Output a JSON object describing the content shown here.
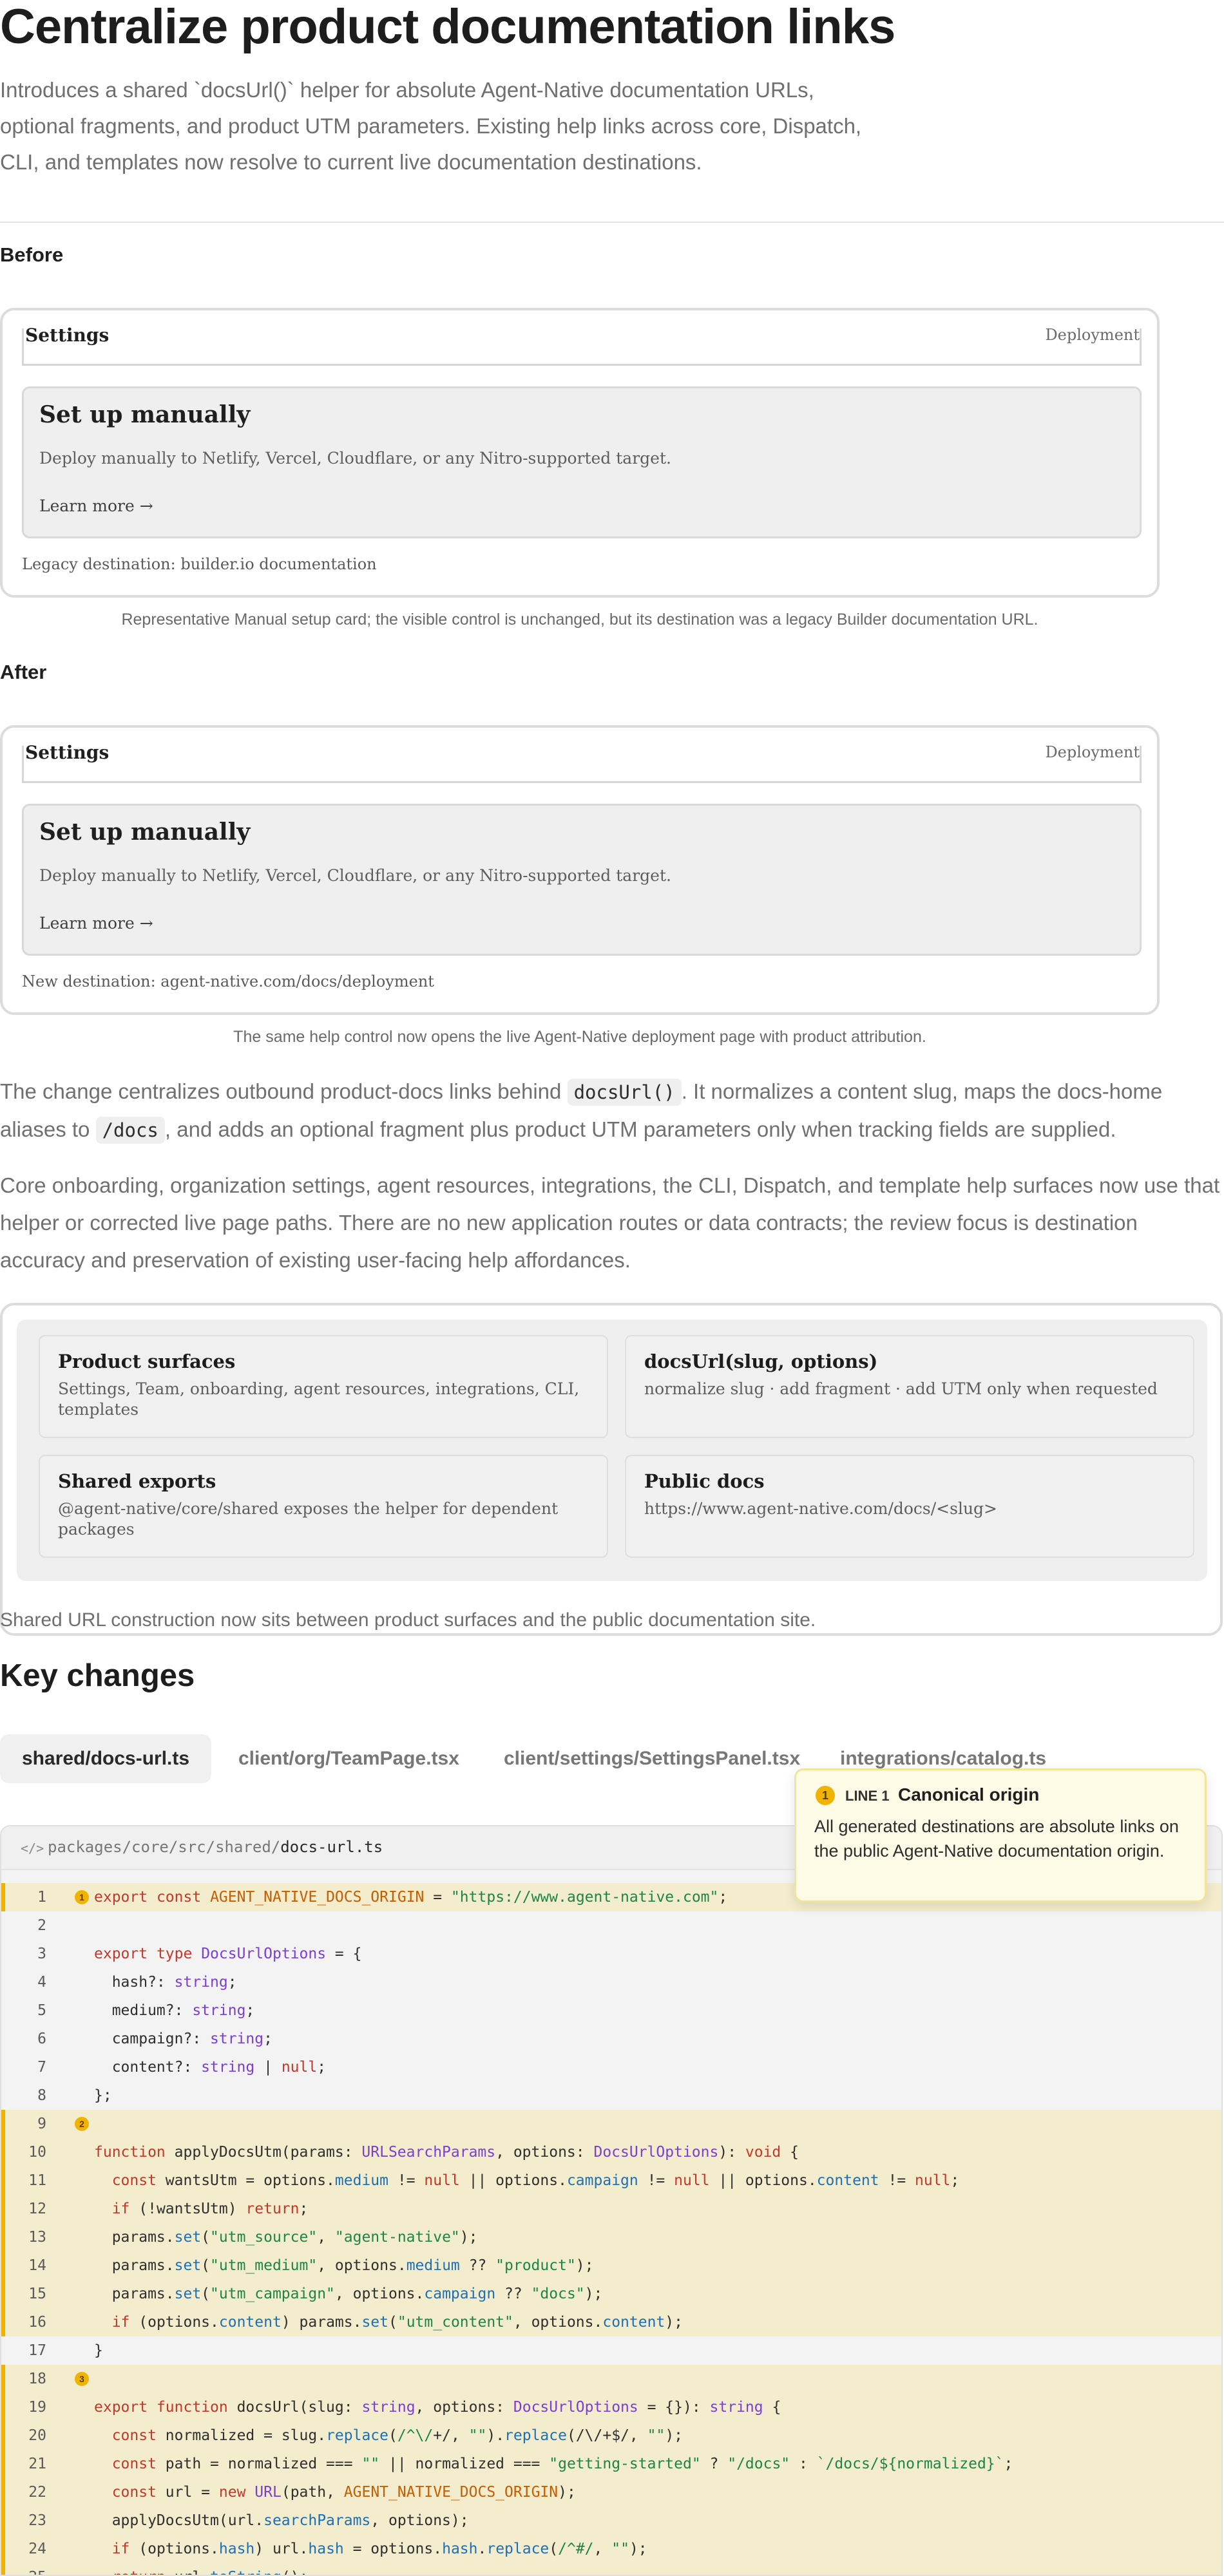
{
  "page": {
    "title": "Centralize product documentation links",
    "subtitle": "Introduces a shared `docsUrl()` helper for absolute Agent-Native documentation URLs, optional fragments, and product UTM parameters. Existing help links across core, Dispatch, CLI, and templates now resolve to current live documentation destinations."
  },
  "before": {
    "heading": "Before",
    "bar_left": "Settings",
    "bar_right": "Deployment",
    "card_title": "Set up manually",
    "card_desc": "Deploy manually to Netlify, Vercel, Cloudflare, or any Nitro-supported target.",
    "card_link": "Learn more →",
    "footer": "Legacy destination: builder.io documentation",
    "caption": "Representative Manual setup card; the visible control is unchanged, but its destination was a legacy Builder documentation URL."
  },
  "after": {
    "heading": "After",
    "bar_left": "Settings",
    "bar_right": "Deployment",
    "card_title": "Set up manually",
    "card_desc": "Deploy manually to Netlify, Vercel, Cloudflare, or any Nitro-supported target.",
    "card_link": "Learn more →",
    "footer": "New destination: agent-native.com/docs/deployment",
    "caption": "The same help control now opens the live Agent-Native deployment page with product attribution."
  },
  "body": {
    "p1_a": "The change centralizes outbound product-docs links behind ",
    "p1_code1": "docsUrl()",
    "p1_b": ". It normalizes a content slug, maps the docs-home aliases to ",
    "p1_code2": "/docs",
    "p1_c": ", and adds an optional fragment plus product UTM parameters only when tracking fields are supplied.",
    "p2": "Core onboarding, organization settings, agent resources, integrations, the CLI, Dispatch, and template help surfaces now use that helper or corrected live page paths. There are no new application routes or data contracts; the review focus is destination accuracy and preservation of existing user-facing help affordances."
  },
  "diagram": {
    "boxes": [
      {
        "title": "Product surfaces",
        "body": "Settings, Team, onboarding, agent resources, integrations, CLI, templates"
      },
      {
        "title": "docsUrl(slug, options)",
        "body": "normalize slug · add fragment · add UTM only when requested"
      },
      {
        "title": "Shared exports",
        "body": "@agent-native/core/shared exposes the helper for dependent packages"
      },
      {
        "title": "Public docs",
        "body": "https://www.agent-native.com/docs/<slug>"
      }
    ],
    "caption": "Shared URL construction now sits between product surfaces and the public documentation site."
  },
  "key_changes": {
    "heading": "Key changes",
    "tabs": [
      "shared/docs-url.ts",
      "client/org/TeamPage.tsx",
      "client/settings/SettingsPanel.tsx",
      "integrations/catalog.ts"
    ],
    "active_tab": "shared/docs-url.ts"
  },
  "tooltip": {
    "number": "1",
    "line_label": "LINE 1",
    "title": "Canonical origin",
    "body": "All generated destinations are absolute links on the public Agent-Native documentation origin."
  },
  "code": {
    "path_prefix": "packages/core/src/shared/",
    "path_file": "docs-url.ts",
    "icon": "code-icon",
    "markers": {
      "1": "1",
      "9": "2",
      "18": "3"
    },
    "lines": [
      "export const AGENT_NATIVE_DOCS_ORIGIN = \"https://www.agent-native.com\";",
      "",
      "export type DocsUrlOptions = {",
      "  hash?: string;",
      "  medium?: string;",
      "  campaign?: string;",
      "  content?: string | null;",
      "};",
      "",
      "function applyDocsUtm(params: URLSearchParams, options: DocsUrlOptions): void {",
      "  const wantsUtm = options.medium != null || options.campaign != null || options.content != null;",
      "  if (!wantsUtm) return;",
      "  params.set(\"utm_source\", \"agent-native\");",
      "  params.set(\"utm_medium\", options.medium ?? \"product\");",
      "  params.set(\"utm_campaign\", options.campaign ?? \"docs\");",
      "  if (options.content) params.set(\"utm_content\", options.content);",
      "}",
      "",
      "export function docsUrl(slug: string, options: DocsUrlOptions = {}): string {",
      "  const normalized = slug.replace(/^\\/+/, \"\").replace(/\\/+$/, \"\");",
      "  const path = normalized === \"\" || normalized === \"getting-started\" ? \"/docs\" : `/docs/${normalized}`;",
      "  const url = new URL(path, AGENT_NATIVE_DOCS_ORIGIN);",
      "  applyDocsUtm(url.searchParams, options);",
      "  if (options.hash) url.hash = options.hash.replace(/^#/, \"\");",
      "  return url.toString();"
    ],
    "highlighted_lines": [
      1,
      9,
      10,
      11,
      12,
      13,
      14,
      15,
      16,
      18,
      19,
      20,
      21,
      22,
      23,
      24,
      25
    ]
  },
  "colors": {
    "accent": "#f0b400",
    "highlight": "#f3edcd",
    "keyword": "#c0392b",
    "type": "#7b3fd3",
    "string": "#1e8449",
    "property": "#1f6fb5"
  }
}
